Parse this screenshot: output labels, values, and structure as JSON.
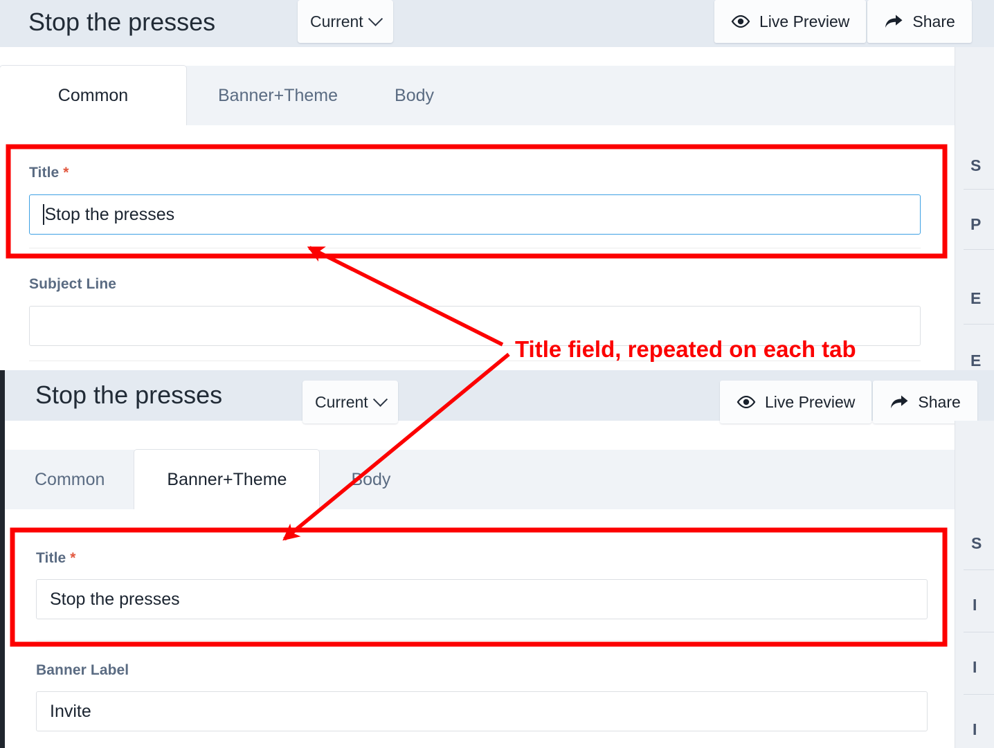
{
  "panels": [
    {
      "id": "top",
      "header": {
        "title": "Stop the presses",
        "version_label": "Current",
        "actions": [
          {
            "label": "Live Preview",
            "icon": "eye-icon"
          },
          {
            "label": "Share",
            "icon": "share-arrow-icon"
          }
        ]
      },
      "tabs": [
        {
          "label": "Common",
          "active": true
        },
        {
          "label": "Banner+Theme",
          "active": false
        },
        {
          "label": "Body",
          "active": false
        }
      ],
      "fields": [
        {
          "label": "Title",
          "required": "*",
          "value": "Stop the presses",
          "focused": true
        },
        {
          "label": "Subject Line",
          "required": "",
          "value": "",
          "focused": false
        }
      ],
      "sidebar_items": [
        "S",
        "P",
        "E",
        "E"
      ]
    },
    {
      "id": "bottom",
      "header": {
        "title": "Stop the presses",
        "version_label": "Current",
        "actions": [
          {
            "label": "Live Preview",
            "icon": "eye-icon"
          },
          {
            "label": "Share",
            "icon": "share-arrow-icon"
          }
        ]
      },
      "tabs": [
        {
          "label": "Common",
          "active": false
        },
        {
          "label": "Banner+Theme",
          "active": true
        },
        {
          "label": "Body",
          "active": false
        }
      ],
      "fields": [
        {
          "label": "Title",
          "required": "*",
          "value": "Stop the presses",
          "focused": false
        },
        {
          "label": "Banner Label",
          "required": "",
          "value": "Invite",
          "focused": false
        }
      ],
      "sidebar_items": [
        "S",
        "I",
        "I",
        "I"
      ]
    }
  ],
  "annotation": {
    "text": "Title field, repeated on each tab",
    "color": "#fc0000"
  },
  "colors": {
    "header_bg": "#e4eaf1",
    "tabstrip_bg": "#f0f3f7",
    "sidebar_bg": "#eef1f5",
    "rail": "#20262e",
    "focus_border": "#3da0e3",
    "required_star": "#e2583f",
    "annotation": "#fc0000"
  }
}
